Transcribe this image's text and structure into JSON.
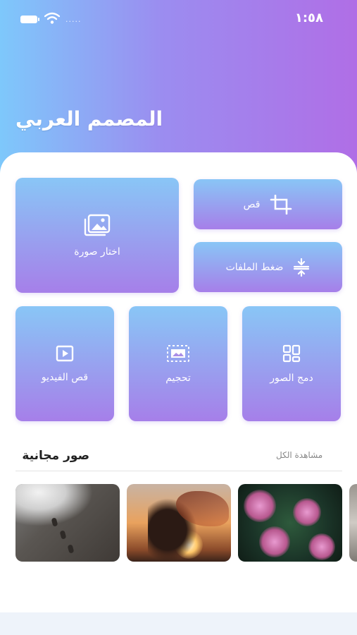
{
  "status_bar": {
    "time": "١:٥٨",
    "carrier_dots": "....."
  },
  "app": {
    "title": "المصمم العربي"
  },
  "tools": {
    "pick_image": {
      "label": "اختار صورة",
      "icon": "image-gallery-icon"
    },
    "crop": {
      "label": "قص",
      "icon": "crop-icon"
    },
    "compress": {
      "label": "ضغط الملفات",
      "icon": "compress-icon"
    },
    "video_crop": {
      "label": "قص الفيديو",
      "icon": "video-play-icon"
    },
    "resize": {
      "label": "تحجيم",
      "icon": "resize-icon"
    },
    "merge": {
      "label": "دمج الصور",
      "icon": "grid-merge-icon"
    }
  },
  "free_photos": {
    "title": "صور مجانية",
    "see_all": "مشاهدة الكل"
  },
  "colors": {
    "gradient_start": "#7ec8fb",
    "gradient_end": "#b06ee6",
    "tile_top": "#89c6f6",
    "tile_bottom": "#a67fe9"
  }
}
